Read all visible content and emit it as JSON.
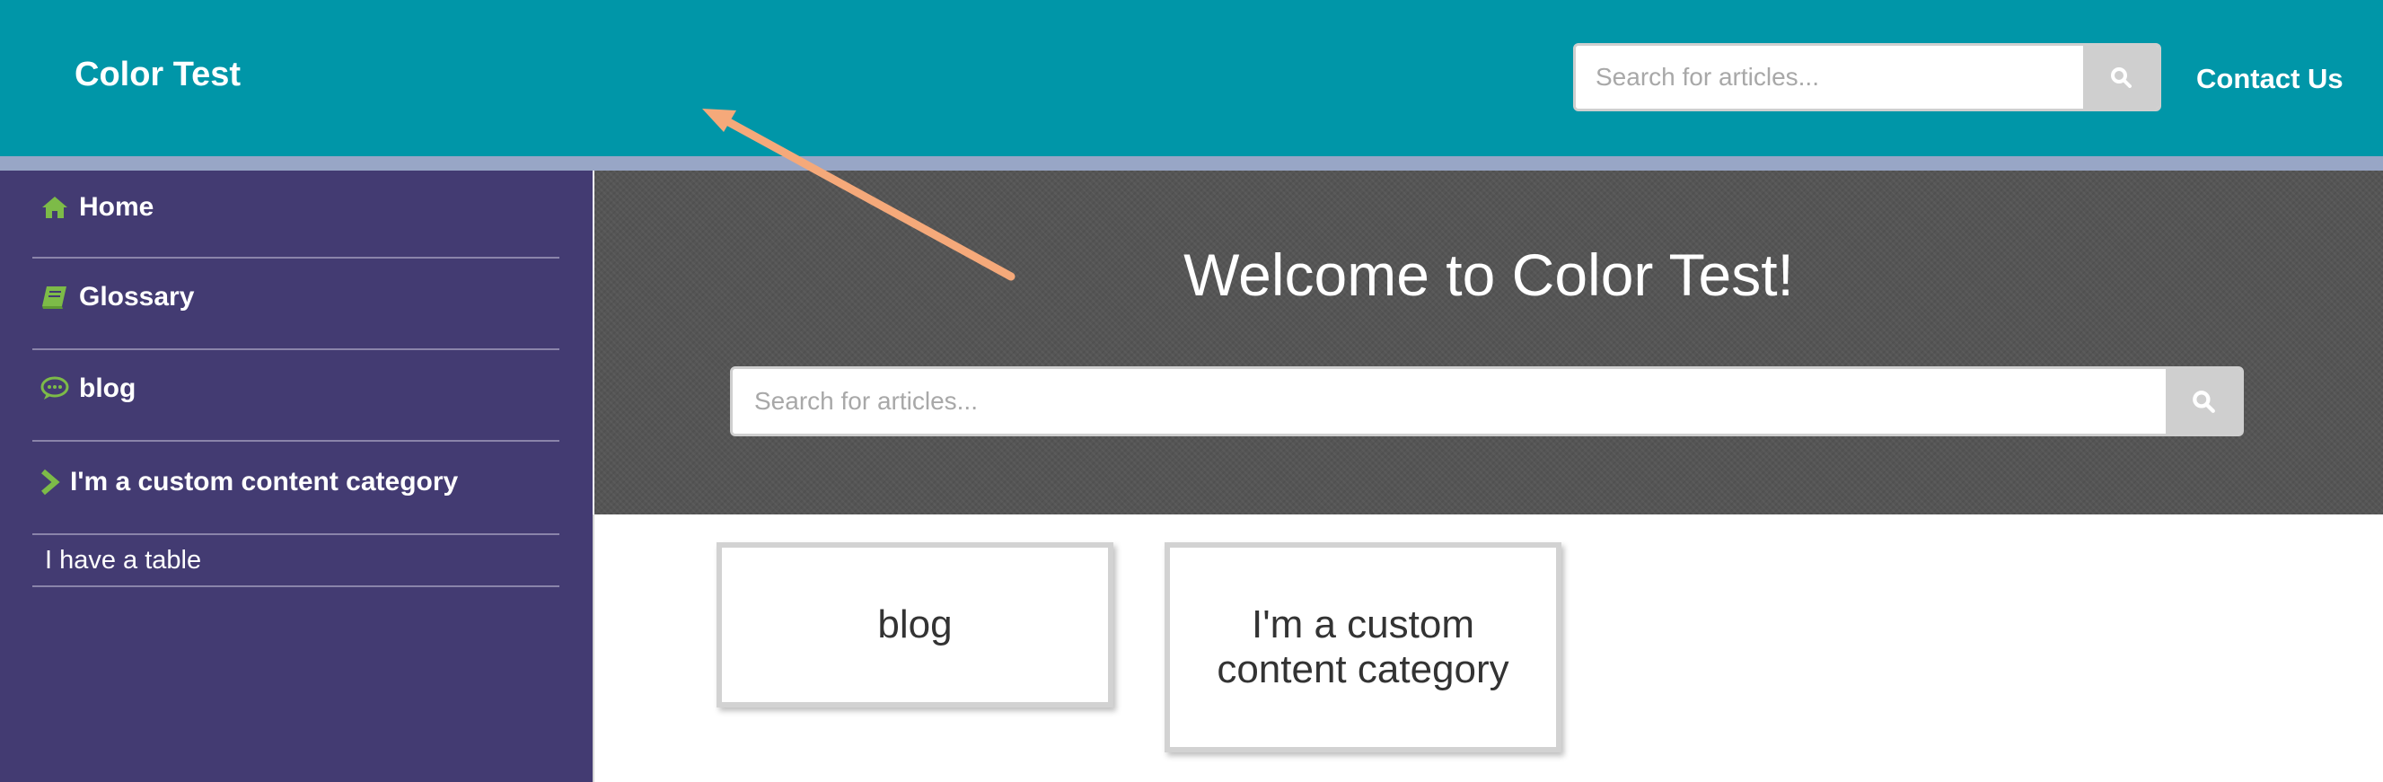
{
  "header": {
    "brand": "Color Test",
    "search_placeholder": "Search for articles...",
    "contact_label": "Contact Us",
    "background_color": "#0096a8"
  },
  "sidebar": {
    "items": [
      {
        "label": "Home",
        "icon": "home-icon"
      },
      {
        "label": "Glossary",
        "icon": "book-icon"
      },
      {
        "label": "blog",
        "icon": "chat-bubble-icon"
      },
      {
        "label": "I'm a custom content category",
        "icon": "chevron-right-icon"
      },
      {
        "label": "I have a table"
      }
    ],
    "background_color": "#433b72",
    "icon_color": "#7dbb48"
  },
  "hero": {
    "title": "Welcome to Color Test!",
    "search_placeholder": "Search for articles..."
  },
  "categories": [
    {
      "label": "blog"
    },
    {
      "label": "I'm a custom content category"
    }
  ],
  "annotation": {
    "type": "arrow",
    "color": "#f5a97a"
  }
}
